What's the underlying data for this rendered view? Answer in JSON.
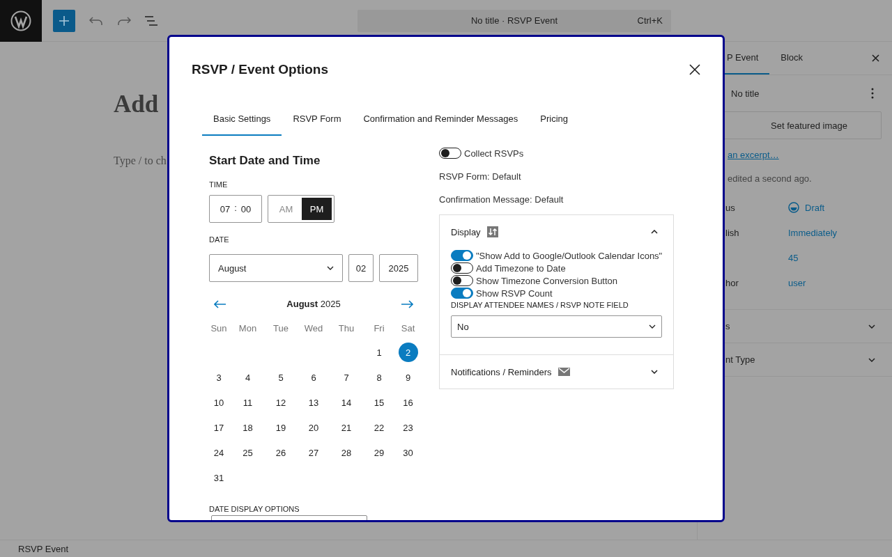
{
  "toolbar": {
    "command_bar": {
      "title": "No title · RSVP Event",
      "shortcut": "Ctrl+K"
    }
  },
  "editor": {
    "title_fragment": "Add",
    "paragraph_fragment": "Type / to ch"
  },
  "sidebar": {
    "tabs": [
      {
        "label": "P Event",
        "selected": true
      },
      {
        "label": "Block",
        "selected": false
      }
    ],
    "post_title": "No title",
    "featured_button": "Set featured image",
    "excerpt_link": "an excerpt…",
    "edited_note": "edited a second ago.",
    "rows": [
      {
        "label": "us",
        "value": "Draft",
        "kind": "status"
      },
      {
        "label": "lish",
        "value": "Immediately",
        "kind": "link"
      },
      {
        "value": "45",
        "kind": "link"
      },
      {
        "label": "hor",
        "value": "user",
        "kind": "link"
      }
    ],
    "sections": [
      {
        "label": "s",
        "expanded": false
      },
      {
        "label": "nt Type",
        "expanded": false
      }
    ]
  },
  "status_bar": {
    "text": "RSVP Event"
  },
  "modal": {
    "title": "RSVP / Event Options",
    "tabs": [
      {
        "label": "Basic Settings",
        "selected": true
      },
      {
        "label": "RSVP Form",
        "selected": false
      },
      {
        "label": "Confirmation and Reminder Messages",
        "selected": false
      },
      {
        "label": "Pricing",
        "selected": false
      }
    ],
    "heading": "Start Date and Time",
    "time_label": "TIME",
    "hour": "07",
    "separator": ":",
    "minute": "00",
    "meridiem": [
      {
        "label": "AM",
        "selected": false
      },
      {
        "label": "PM",
        "selected": true
      }
    ],
    "date_label": "DATE",
    "month_select": "August",
    "day": "02",
    "year": "2025",
    "calendar": {
      "month": "August",
      "year": "2025",
      "weekdays": [
        "Sun",
        "Mon",
        "Tue",
        "Wed",
        "Thu",
        "Fri",
        "Sat"
      ],
      "weeks": [
        {
          "kind": "end",
          "days": [
            {
              "day": "1",
              "selected": false
            },
            {
              "day": "2",
              "selected": true
            }
          ]
        },
        {
          "kind": "full",
          "days": [
            {
              "day": "3",
              "selected": false
            },
            {
              "day": "4",
              "selected": false
            },
            {
              "day": "5",
              "selected": false
            },
            {
              "day": "6",
              "selected": false
            },
            {
              "day": "7",
              "selected": false
            },
            {
              "day": "8",
              "selected": false
            },
            {
              "day": "9",
              "selected": false
            }
          ]
        },
        {
          "kind": "full",
          "days": [
            {
              "day": "10",
              "selected": false
            },
            {
              "day": "11",
              "selected": false
            },
            {
              "day": "12",
              "selected": false
            },
            {
              "day": "13",
              "selected": false
            },
            {
              "day": "14",
              "selected": false
            },
            {
              "day": "15",
              "selected": false
            },
            {
              "day": "16",
              "selected": false
            }
          ]
        },
        {
          "kind": "full",
          "days": [
            {
              "day": "17",
              "selected": false
            },
            {
              "day": "18",
              "selected": false
            },
            {
              "day": "19",
              "selected": false
            },
            {
              "day": "20",
              "selected": false
            },
            {
              "day": "21",
              "selected": false
            },
            {
              "day": "22",
              "selected": false
            },
            {
              "day": "23",
              "selected": false
            }
          ]
        },
        {
          "kind": "full",
          "days": [
            {
              "day": "24",
              "selected": false
            },
            {
              "day": "25",
              "selected": false
            },
            {
              "day": "26",
              "selected": false
            },
            {
              "day": "27",
              "selected": false
            },
            {
              "day": "28",
              "selected": false
            },
            {
              "day": "29",
              "selected": false
            },
            {
              "day": "30",
              "selected": false
            }
          ]
        },
        {
          "kind": "start",
          "days": [
            {
              "day": "31",
              "selected": false
            }
          ]
        }
      ]
    },
    "date_display_label": "DATE DISPLAY OPTIONS",
    "collect_rsvps": {
      "label": "Collect RSVPs",
      "on": false
    },
    "rsvp_form_note": "RSVP Form: Default",
    "confirmation_note": "Confirmation Message: Default",
    "panels": [
      {
        "title": "Display",
        "kind": "display",
        "expanded": true,
        "toggles": [
          {
            "label": "\"Show Add to Google/Outlook Calendar Icons\"",
            "on": true
          },
          {
            "label": "Add Timezone to Date",
            "on": false
          },
          {
            "label": "Show Timezone Conversion Button",
            "on": false
          },
          {
            "label": "Show RSVP Count",
            "on": true
          }
        ],
        "select_label": "DISPLAY ATTENDEE NAMES / RSVP NOTE FIELD",
        "select_value": "No"
      },
      {
        "title": "Notifications / Reminders",
        "kind": "notifications",
        "expanded": false
      }
    ]
  }
}
